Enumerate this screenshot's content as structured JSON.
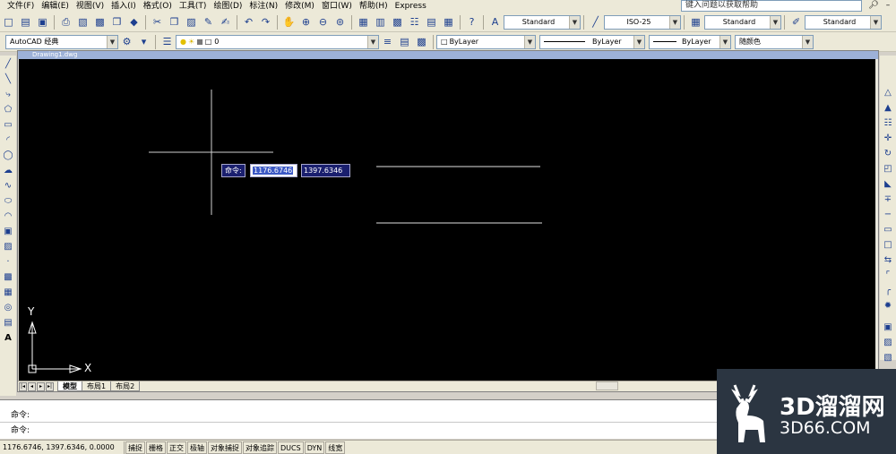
{
  "menu": {
    "items": [
      "文件(F)",
      "编辑(E)",
      "视图(V)",
      "插入(I)",
      "格式(O)",
      "工具(T)",
      "绘图(D)",
      "标注(N)",
      "修改(M)",
      "窗口(W)",
      "帮助(H)",
      "Express"
    ],
    "help_placeholder": "键入问题以获取帮助"
  },
  "toolbar1": {
    "text_style": "Standard",
    "dim_style": "ISO-25",
    "table_style": "Standard",
    "multileader_style": "Standard"
  },
  "toolbar2": {
    "workspace": "AutoCAD 经典",
    "layer": "0",
    "color": "ByLayer",
    "linetype": "ByLayer",
    "lineweight": "ByLayer",
    "plot_style": "随颜色"
  },
  "document": {
    "title": "Drawing1.dwg"
  },
  "tabs": {
    "model": "模型",
    "layout1": "布局1",
    "layout2": "布局2"
  },
  "dynamic_input": {
    "prompt": "命令:",
    "x_value": "1176.6746",
    "y_value": "1397.6346"
  },
  "ucs": {
    "y_label": "Y",
    "x_label": "X"
  },
  "command": {
    "line1": "命令:",
    "line2": "命令:"
  },
  "status": {
    "coordinates": "1176.6746, 1397.6346, 0.0000",
    "buttons": [
      "捕捉",
      "栅格",
      "正交",
      "极轴",
      "对象捕捉",
      "对象追踪",
      "DUCS",
      "DYN",
      "线宽"
    ]
  },
  "watermark": {
    "brand": "3D溜溜网",
    "domain": "3D66.COM"
  }
}
